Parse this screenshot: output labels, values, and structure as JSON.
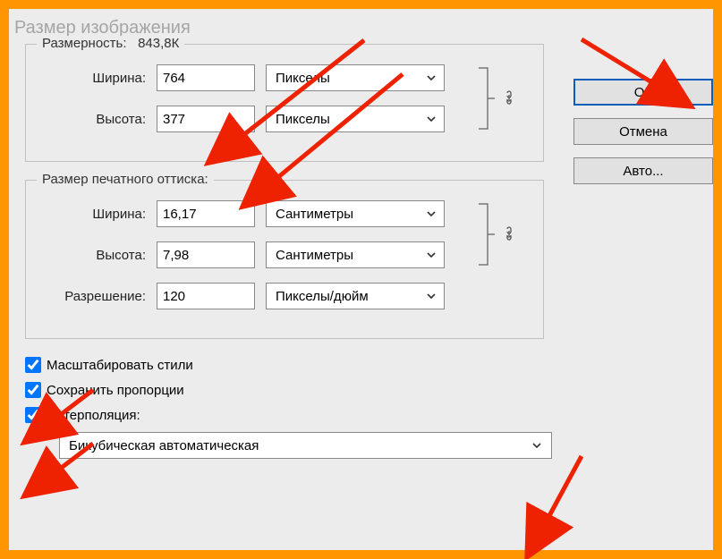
{
  "title": "Размер изображения",
  "dimension": {
    "legend": "Размерность:",
    "filesize": "843,8К",
    "width_label": "Ширина:",
    "width_value": "764",
    "height_label": "Высота:",
    "height_value": "377",
    "unit1": "Пикселы",
    "unit2": "Пикселы"
  },
  "print": {
    "legend": "Размер печатного оттиска:",
    "width_label": "Ширина:",
    "width_value": "16,17",
    "height_label": "Высота:",
    "height_value": "7,98",
    "res_label": "Разрешение:",
    "res_value": "120",
    "unit1": "Сантиметры",
    "unit2": "Сантиметры",
    "unit3": "Пикселы/дюйм"
  },
  "checks": {
    "scale_styles": "Масштабировать стили",
    "constrain": "Сохранить пропорции",
    "interpolation": "Интерполяция:"
  },
  "interp_method": "Бикубическая автоматическая",
  "buttons": {
    "ok": "ОК",
    "cancel": "Отмена",
    "auto": "Авто..."
  }
}
